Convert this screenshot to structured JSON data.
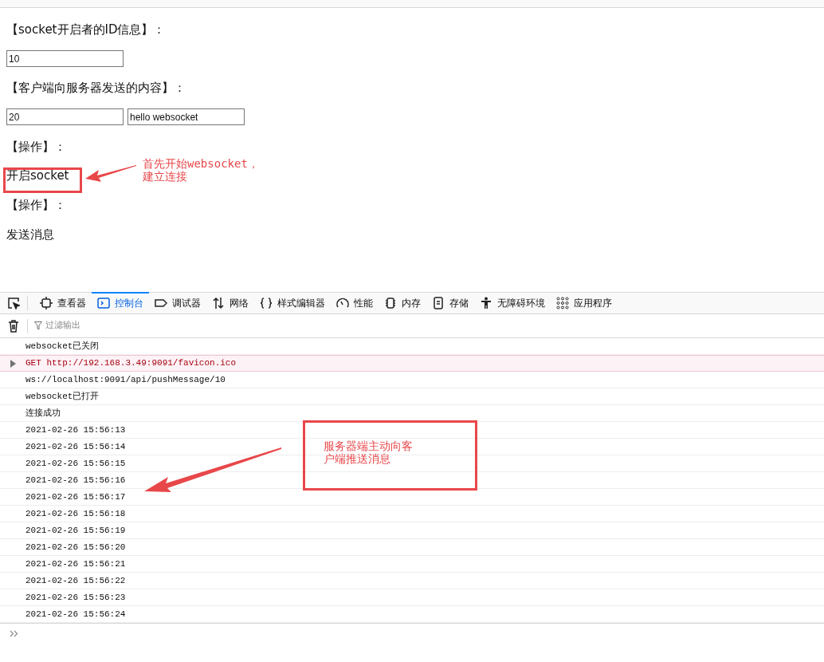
{
  "page": {
    "id_label": "【socket开启者的ID信息】：",
    "id_value": "10",
    "content_label": "【客户端向服务器发送的内容】：",
    "content_id_value": "20",
    "content_text_value": "hello websocket",
    "op_label_1": "【操作】：",
    "open_button": "开启socket",
    "op_label_2": "【操作】：",
    "send_button": "发送消息"
  },
  "annotations": [
    {
      "lines": [
        "首先开始websocket，",
        "建立连接"
      ]
    },
    {
      "lines": [
        "服务器端主动向客",
        "户端推送消息"
      ]
    }
  ],
  "devtools": {
    "tabs": [
      {
        "label": "查看器",
        "selected": false
      },
      {
        "label": "控制台",
        "selected": true
      },
      {
        "label": "调试器",
        "selected": false
      },
      {
        "label": "网络",
        "selected": false
      },
      {
        "label": "样式编辑器",
        "selected": false
      },
      {
        "label": "性能",
        "selected": false
      },
      {
        "label": "内存",
        "selected": false
      },
      {
        "label": "存储",
        "selected": false
      },
      {
        "label": "无障碍环境",
        "selected": false
      },
      {
        "label": "应用程序",
        "selected": false
      }
    ],
    "filter_placeholder": "过滤输出",
    "log": [
      {
        "kind": "log",
        "text": "websocket已关闭"
      },
      {
        "kind": "request",
        "text": "GET http://192.168.3.49:9091/favicon.ico"
      },
      {
        "kind": "log",
        "text": "ws://localhost:9091/api/pushMessage/10"
      },
      {
        "kind": "log",
        "text": "websocket已打开"
      },
      {
        "kind": "log",
        "text": "连接成功"
      },
      {
        "kind": "log",
        "text": "2021-02-26 15:56:13"
      },
      {
        "kind": "log",
        "text": "2021-02-26 15:56:14"
      },
      {
        "kind": "log",
        "text": "2021-02-26 15:56:15"
      },
      {
        "kind": "log",
        "text": "2021-02-26 15:56:16"
      },
      {
        "kind": "log",
        "text": "2021-02-26 15:56:17"
      },
      {
        "kind": "log",
        "text": "2021-02-26 15:56:18"
      },
      {
        "kind": "log",
        "text": "2021-02-26 15:56:19"
      },
      {
        "kind": "log",
        "text": "2021-02-26 15:56:20"
      },
      {
        "kind": "log",
        "text": "2021-02-26 15:56:21"
      },
      {
        "kind": "log",
        "text": "2021-02-26 15:56:22"
      },
      {
        "kind": "log",
        "text": "2021-02-26 15:56:23"
      },
      {
        "kind": "log",
        "text": "2021-02-26 15:56:24"
      }
    ]
  }
}
